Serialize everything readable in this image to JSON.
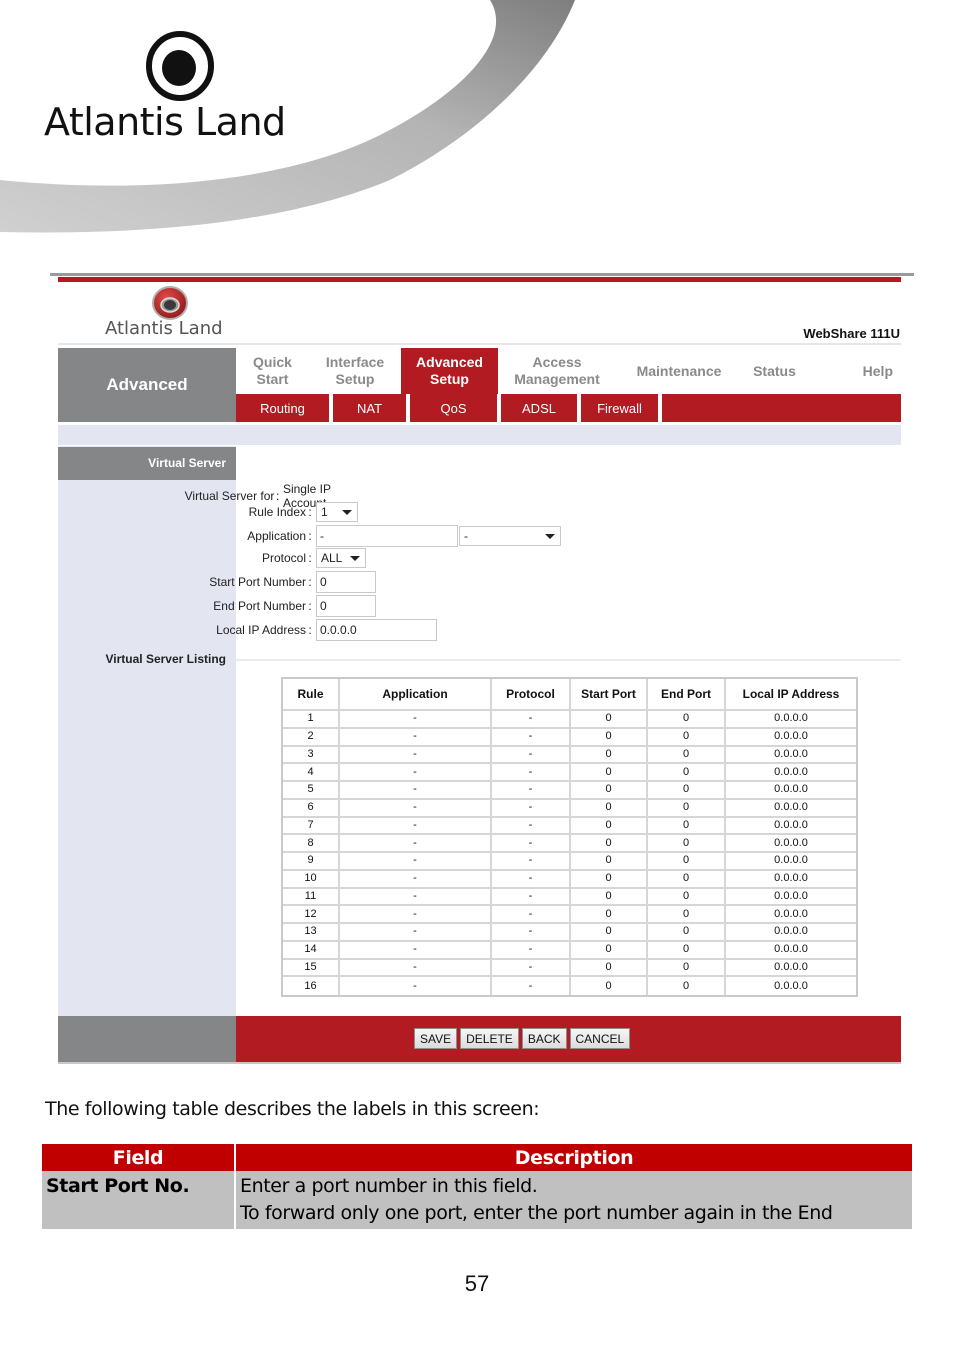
{
  "document": {
    "brand": "Atlantis Land",
    "intro_text": "The following table describes the labels in this screen:",
    "page_number": "57",
    "accent_color": "#c00000",
    "description_table": {
      "headers": {
        "field": "Field",
        "description": "Description"
      },
      "rows": [
        {
          "field": "Start Port No.",
          "description_lines": [
            "Enter a port number in this field.",
            "To forward only one port, enter the port number again in the End"
          ]
        }
      ]
    }
  },
  "router_ui": {
    "brand": "Atlantis Land",
    "model": "WebShare 111U",
    "accent_color": "#b31b22",
    "section_title": "Advanced",
    "main_tabs": [
      {
        "line1": "Quick",
        "line2": "Start",
        "active": false
      },
      {
        "line1": "Interface",
        "line2": "Setup",
        "active": false
      },
      {
        "line1": "Advanced",
        "line2": "Setup",
        "active": true
      },
      {
        "line1": "Access",
        "line2": "Management",
        "active": false
      },
      {
        "line1": "Maintenance",
        "line2": "",
        "active": false
      },
      {
        "line1": "Status",
        "line2": "",
        "active": false
      },
      {
        "line1": "Help",
        "line2": "",
        "active": false
      }
    ],
    "sub_tabs": [
      "Routing",
      "NAT",
      "QoS",
      "ADSL",
      "Firewall"
    ],
    "virtual_server_heading": "Virtual Server",
    "listing_heading": "Virtual Server Listing",
    "form": {
      "virtual_server_for": {
        "label": "Virtual Server for",
        "value": "Single IP Account"
      },
      "rule_index": {
        "label": "Rule Index",
        "value": "1"
      },
      "application": {
        "label": "Application",
        "value": "-",
        "select_value": "-"
      },
      "protocol": {
        "label": "Protocol",
        "value": "ALL"
      },
      "start_port": {
        "label": "Start Port Number",
        "value": "0"
      },
      "end_port": {
        "label": "End Port Number",
        "value": "0"
      },
      "local_ip": {
        "label": "Local IP Address",
        "value": "0.0.0.0"
      }
    },
    "listing_table": {
      "headers": [
        "Rule",
        "Application",
        "Protocol",
        "Start Port",
        "End Port",
        "Local IP Address"
      ],
      "rows": [
        [
          "1",
          "-",
          "-",
          "0",
          "0",
          "0.0.0.0"
        ],
        [
          "2",
          "-",
          "-",
          "0",
          "0",
          "0.0.0.0"
        ],
        [
          "3",
          "-",
          "-",
          "0",
          "0",
          "0.0.0.0"
        ],
        [
          "4",
          "-",
          "-",
          "0",
          "0",
          "0.0.0.0"
        ],
        [
          "5",
          "-",
          "-",
          "0",
          "0",
          "0.0.0.0"
        ],
        [
          "6",
          "-",
          "-",
          "0",
          "0",
          "0.0.0.0"
        ],
        [
          "7",
          "-",
          "-",
          "0",
          "0",
          "0.0.0.0"
        ],
        [
          "8",
          "-",
          "-",
          "0",
          "0",
          "0.0.0.0"
        ],
        [
          "9",
          "-",
          "-",
          "0",
          "0",
          "0.0.0.0"
        ],
        [
          "10",
          "-",
          "-",
          "0",
          "0",
          "0.0.0.0"
        ],
        [
          "11",
          "-",
          "-",
          "0",
          "0",
          "0.0.0.0"
        ],
        [
          "12",
          "-",
          "-",
          "0",
          "0",
          "0.0.0.0"
        ],
        [
          "13",
          "-",
          "-",
          "0",
          "0",
          "0.0.0.0"
        ],
        [
          "14",
          "-",
          "-",
          "0",
          "0",
          "0.0.0.0"
        ],
        [
          "15",
          "-",
          "-",
          "0",
          "0",
          "0.0.0.0"
        ],
        [
          "16",
          "-",
          "-",
          "0",
          "0",
          "0.0.0.0"
        ]
      ]
    },
    "buttons": {
      "save": "SAVE",
      "delete": "DELETE",
      "back": "BACK",
      "cancel": "CANCEL"
    }
  }
}
